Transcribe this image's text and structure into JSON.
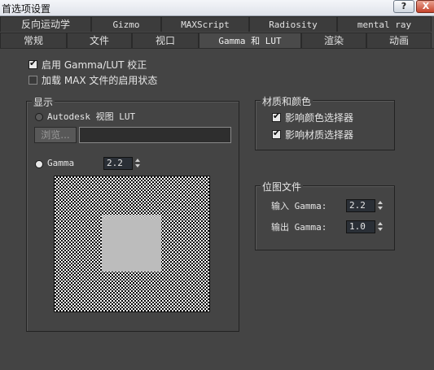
{
  "window": {
    "title": "首选项设置",
    "help_label": "?",
    "close_label": "X"
  },
  "tabs_row1": [
    "反向运动学",
    "Gizmo",
    "MAXScript",
    "Radiosity",
    "mental ray"
  ],
  "tabs_row2": [
    "常规",
    "文件",
    "视口",
    "Gamma 和 LUT",
    "渲染",
    "动画"
  ],
  "options": {
    "enable_gamma": {
      "label": "启用 Gamma/LUT 校正",
      "checked": true
    },
    "load_state": {
      "label": "加载 MAX 文件的启用状态",
      "checked": false
    }
  },
  "display": {
    "group_label": "显示",
    "autodesk_label": "Autodesk 视图 LUT",
    "browse_label": "浏览...",
    "path_value": "",
    "gamma_label": "Gamma",
    "gamma_value": "2.2"
  },
  "materials": {
    "group_label": "材质和颜色",
    "affect_color": {
      "label": "影响颜色选择器",
      "checked": true
    },
    "affect_material": {
      "label": "影响材质选择器",
      "checked": true
    }
  },
  "bitmap": {
    "group_label": "位图文件",
    "input_label": "输入 Gamma:",
    "input_value": "2.2",
    "output_label": "输出 Gamma:",
    "output_value": "1.0"
  }
}
